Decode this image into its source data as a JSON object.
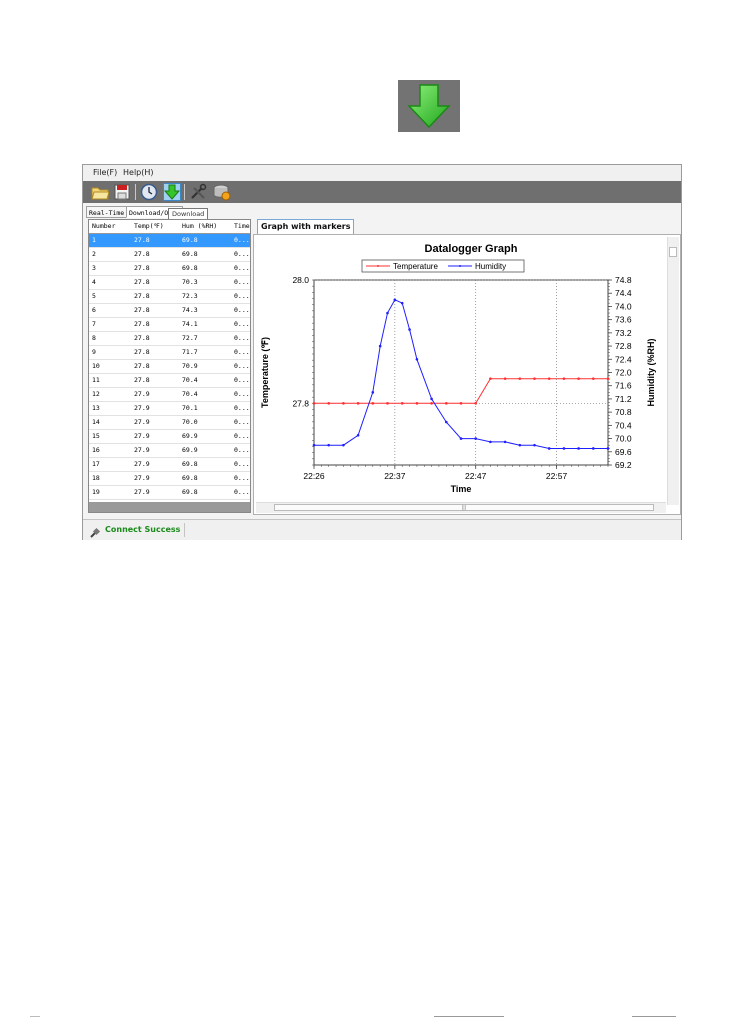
{
  "menu": {
    "file": "File(F)",
    "help": "Help(H)"
  },
  "toolbar": {
    "buttons": [
      "open-folder-icon",
      "save-icon",
      "clock-icon",
      "download-icon",
      "tools-icon",
      "database-icon"
    ],
    "download_tooltip": "Download"
  },
  "tabs": {
    "realtime": "Real-Time",
    "download_open": "Download/Open"
  },
  "table": {
    "columns": [
      "Number",
      "Temp(℉)",
      "Hum (%RH)",
      "Time"
    ],
    "rows": [
      [
        "1",
        "27.8",
        "69.8",
        "0..."
      ],
      [
        "2",
        "27.8",
        "69.8",
        "0..."
      ],
      [
        "3",
        "27.8",
        "69.8",
        "0..."
      ],
      [
        "4",
        "27.8",
        "70.3",
        "0..."
      ],
      [
        "5",
        "27.8",
        "72.3",
        "0..."
      ],
      [
        "6",
        "27.8",
        "74.3",
        "0..."
      ],
      [
        "7",
        "27.8",
        "74.1",
        "0..."
      ],
      [
        "8",
        "27.8",
        "72.7",
        "0..."
      ],
      [
        "9",
        "27.8",
        "71.7",
        "0..."
      ],
      [
        "10",
        "27.8",
        "70.9",
        "0..."
      ],
      [
        "11",
        "27.8",
        "70.4",
        "0..."
      ],
      [
        "12",
        "27.9",
        "70.4",
        "0..."
      ],
      [
        "13",
        "27.9",
        "70.1",
        "0..."
      ],
      [
        "14",
        "27.9",
        "70.0",
        "0..."
      ],
      [
        "15",
        "27.9",
        "69.9",
        "0..."
      ],
      [
        "16",
        "27.9",
        "69.9",
        "0..."
      ],
      [
        "17",
        "27.9",
        "69.8",
        "0..."
      ],
      [
        "18",
        "27.9",
        "69.8",
        "0..."
      ],
      [
        "19",
        "27.9",
        "69.8",
        "0..."
      ]
    ],
    "selected_row": 0
  },
  "graph_tab_label": "Graph with markers",
  "status": {
    "text": "Connect Success"
  },
  "colors": {
    "temperature": "#ff3030",
    "humidity": "#1f1fff",
    "status_green": "#1a8b1a",
    "selection": "#3399ff",
    "arrow_green": "#3fcf2f"
  },
  "chart_data": {
    "type": "line",
    "title": "Datalogger Graph",
    "xlabel": "Time",
    "ylabel": "Temperature (℉)",
    "y2label": "Humidity (%RH)",
    "legend": [
      "Temperature",
      "Humidity"
    ],
    "legend_position": "top",
    "x_ticks": [
      "22:26",
      "22:37",
      "22:47",
      "22:57"
    ],
    "xlim": [
      0,
      40
    ],
    "x_tick_positions": [
      0,
      11,
      22,
      33
    ],
    "ylim": [
      27.7,
      28.0
    ],
    "y_ticks": [
      "27.8",
      "28.0"
    ],
    "y2lim": [
      69.2,
      74.8
    ],
    "y2_ticks": [
      "69.2",
      "69.6",
      "70.0",
      "70.4",
      "70.8",
      "71.2",
      "71.6",
      "72.0",
      "72.4",
      "72.8",
      "73.2",
      "73.6",
      "74.0",
      "74.4",
      "74.8"
    ],
    "grid": true,
    "series": [
      {
        "name": "Temperature",
        "axis": "left",
        "x": [
          0,
          2,
          4,
          6,
          8,
          10,
          12,
          14,
          16,
          18,
          20,
          22,
          24,
          26,
          28,
          30,
          32,
          34,
          36,
          38,
          40
        ],
        "values": [
          27.8,
          27.8,
          27.8,
          27.8,
          27.8,
          27.8,
          27.8,
          27.8,
          27.8,
          27.8,
          27.8,
          27.8,
          27.84,
          27.84,
          27.84,
          27.84,
          27.84,
          27.84,
          27.84,
          27.84,
          27.84
        ]
      },
      {
        "name": "Humidity",
        "axis": "right",
        "x": [
          0,
          2,
          4,
          6,
          8,
          9,
          10,
          11,
          12,
          13,
          14,
          16,
          18,
          20,
          22,
          24,
          26,
          28,
          30,
          32,
          34,
          36,
          38,
          40
        ],
        "values": [
          69.8,
          69.8,
          69.8,
          70.1,
          71.4,
          72.8,
          73.8,
          74.2,
          74.1,
          73.3,
          72.4,
          71.2,
          70.5,
          70.0,
          70.0,
          69.9,
          69.9,
          69.8,
          69.8,
          69.7,
          69.7,
          69.7,
          69.7,
          69.7
        ]
      }
    ]
  }
}
